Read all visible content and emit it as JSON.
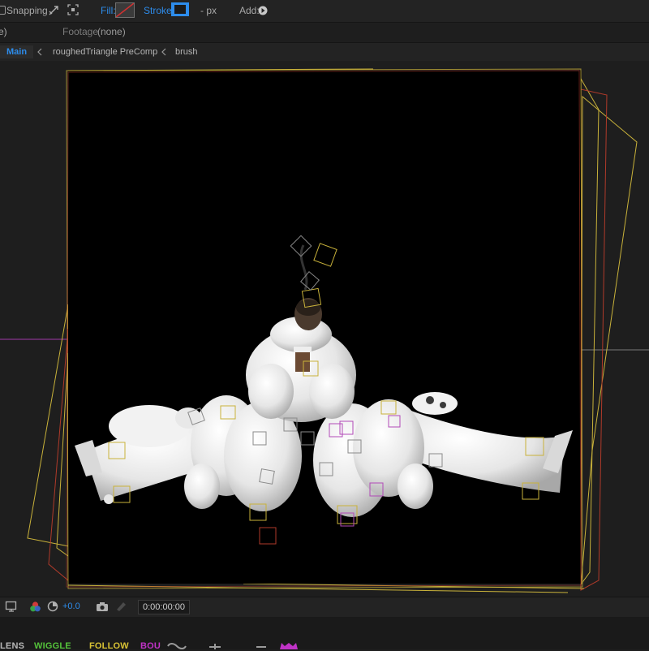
{
  "toolbar": {
    "snapping_label": "Snapping",
    "fill_label": "Fill:",
    "stroke_label": "Stroke:",
    "stroke_width": "- px",
    "add_label": "Add:"
  },
  "tabs": {
    "composition_tail": "e)",
    "footage_label": "Footage",
    "footage_value": "(none)"
  },
  "breadcrumb": {
    "items": [
      "Main",
      "roughedTriangle PreComp",
      "brush"
    ]
  },
  "statusbar": {
    "exposure": "+0.0",
    "timecode": "0:00:00:00"
  },
  "scripts_panel": {
    "buttons": [
      "LENS",
      "WIGGLE",
      "FOLLOW",
      "BOU"
    ]
  },
  "colors": {
    "accent": "#2d8ceb",
    "lens": "#b8b8b8",
    "wiggle": "#54c23a",
    "follow": "#d8c234",
    "bounce": "#c033c7",
    "layer_outline_yellow": "#c9b23a",
    "layer_outline_red": "#b03a2a"
  },
  "viewer": {
    "artwork": "white-figure-with-cows"
  }
}
